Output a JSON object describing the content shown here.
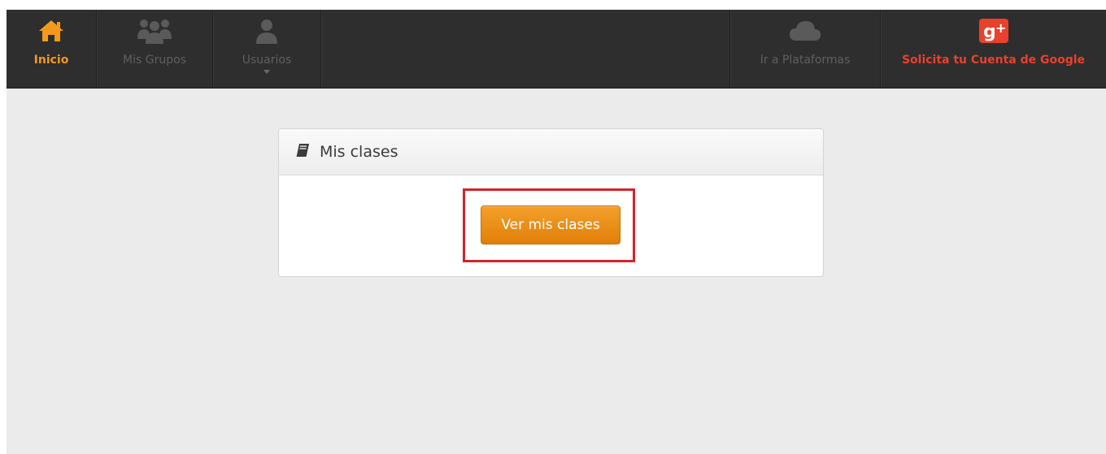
{
  "nav": {
    "inicio": {
      "label": "Inicio",
      "icon": "home-icon",
      "color": "#f39a1c"
    },
    "grupos": {
      "label": "Mis Grupos",
      "icon": "group-icon"
    },
    "usuarios": {
      "label": "Usuarios",
      "icon": "user-icon"
    },
    "plataformas": {
      "label": "Ir a Plataformas",
      "icon": "cloud-icon"
    },
    "google": {
      "label": "Solicita tu Cuenta de Google",
      "icon": "google-plus-icon",
      "color": "#e8412c"
    }
  },
  "panel": {
    "title": "Mis clases",
    "icon": "book-icon",
    "button_label": "Ver mis clases"
  },
  "colors": {
    "accent": "#f39a1c",
    "highlight": "#d4232b"
  }
}
